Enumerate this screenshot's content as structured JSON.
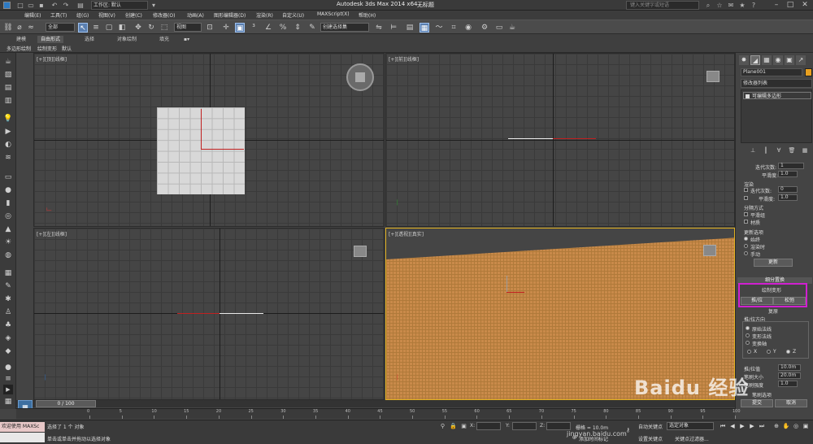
{
  "titlebar": {
    "workspace": "工作区: 默认",
    "app_title": "Autodesk 3ds Max  2014 x64",
    "file_title": "无标题",
    "search_placeholder": "键入关键字或短语"
  },
  "menu": [
    "编辑(E)",
    "工具(T)",
    "组(G)",
    "视图(V)",
    "创建(C)",
    "修改器(O)",
    "动画(A)",
    "图形编辑器(D)",
    "渲染(R)",
    "自定义(U)",
    "MAXScript(X)",
    "帮助(H)"
  ],
  "toolbar": {
    "selection_filter": "全部",
    "ref_coord": "视图",
    "named_selection": "创建选择集"
  },
  "ribbon": {
    "tabs": [
      "建模",
      "自由形式",
      "选择",
      "对象绘制",
      "填充"
    ],
    "active_tab": 1,
    "sub": [
      "多边形绘制",
      "绘制变形",
      "默认"
    ]
  },
  "viewports": {
    "top": "[+][顶][线框]",
    "front": "[+][前][线框]",
    "left": "[+][左][线框]",
    "perspective": "[+][透视][真实]"
  },
  "command_panel": {
    "object_name": "Plane001",
    "object_color": "#e8a020",
    "modifier_list": "修改器列表",
    "stack_item": "可编辑多边形",
    "subdiv": {
      "iterations_label": "迭代次数:",
      "iterations_value": "1",
      "smoothness_label": "平滑度:",
      "smoothness_value": "1.0",
      "render_label": "渲染",
      "render_iter_label": "迭代次数:",
      "render_iter_value": "0",
      "render_smooth_label": "平滑度:",
      "render_smooth_value": "1.0",
      "sep_label": "分隔方式",
      "sep_smoothing": "平滑组",
      "sep_material": "材质",
      "update_label": "更新选项",
      "update_always": "始终",
      "update_render": "渲染时",
      "update_manual": "手动",
      "update_button": "更新"
    },
    "rollout_subdiv_disp": "细分置换",
    "rollout_paint_deform": "绘制变形",
    "push_pull_button": "推/拉",
    "relax_button": "松弛",
    "revert_button": "复原",
    "push_dir_label": "推/拉方向",
    "dir_original_normals": "原始法线",
    "dir_deformed_normals": "变形法线",
    "dir_transform_axis": "变换轴",
    "axis_x": "X",
    "axis_y": "Y",
    "axis_z": "Z",
    "push_value_label": "推/拉值",
    "push_value": "10.0m",
    "brush_size_label": "笔刷大小",
    "brush_size": "20.0m",
    "brush_strength_label": "笔刷强度",
    "brush_strength": "1.0",
    "brush_options": "笔刷选项",
    "commit_button": "提交",
    "cancel_button": "取消"
  },
  "timeline": {
    "frame": "0 / 100",
    "ticks": [
      "0",
      "5",
      "10",
      "15",
      "20",
      "25",
      "30",
      "35",
      "40",
      "45",
      "50",
      "55",
      "60",
      "65",
      "70",
      "75",
      "80",
      "85",
      "90",
      "95",
      "100"
    ]
  },
  "statusbar": {
    "maxscript_label": "欢迎使用 MAXSc",
    "selected": "选择了 1 个 对象",
    "prompt": "单击或单击并拖动以选择对象",
    "x_label": "X:",
    "y_label": "Y:",
    "z_label": "Z:",
    "grid": "栅格 = 10.0m",
    "add_time_tag": "添加时间标记",
    "auto_key": "自动关键点",
    "set_key": "设置关键点",
    "key_filter": "选定对象",
    "key_filters_btn": "关键点过滤器..."
  },
  "watermark": {
    "logo": "Baidu 经验",
    "url": "jingyan.baidu.com"
  },
  "colors": {
    "accent_selected_tool": "#5a7fb0",
    "highlight_box": "#d020d0",
    "perspective_floor": "#c98a4a",
    "active_viewport_border": "#e0b020"
  }
}
